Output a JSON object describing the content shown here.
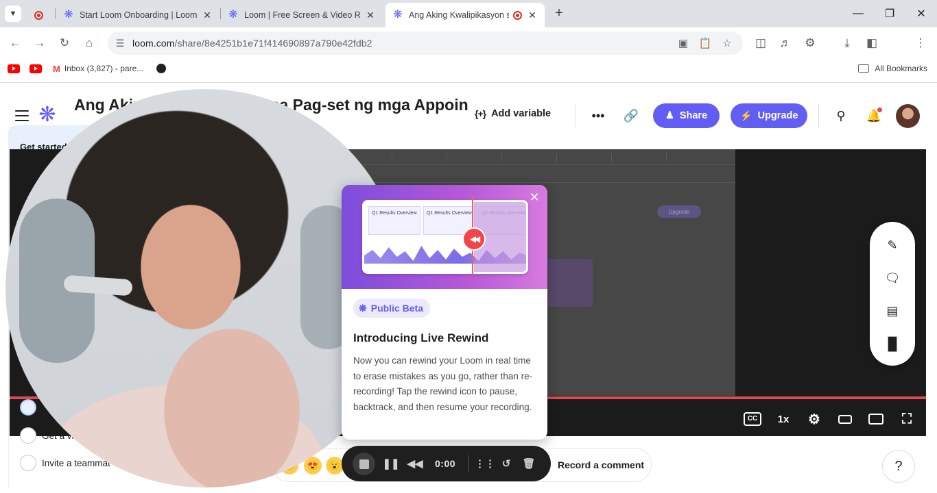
{
  "browser": {
    "tabs": [
      {
        "title": "",
        "icon": "recording-icon"
      },
      {
        "title": "Start Loom Onboarding | Loom",
        "icon": "loom-icon"
      },
      {
        "title": "Loom | Free Screen & Video Re",
        "icon": "loom-icon"
      },
      {
        "title": "Ang Aking Kwalipikasyon sa",
        "icon": "loom-icon",
        "active": true
      }
    ],
    "url_domain": "loom.com",
    "url_path": "/share/8e4251b1e71f414690897a790e42fdb2",
    "bookmarks": {
      "inbox": "Inbox (3,827) - pare...",
      "all": "All Bookmarks"
    }
  },
  "header": {
    "title": "Ang Aking Kwalipikasyon sa Pag-set ng mga Appoin...",
    "add_variable": "Add variable",
    "share": "Share",
    "upgrade": "Upgrade"
  },
  "onboarding": {
    "title": "Get started",
    "progress": 0.4,
    "tasks": [
      {
        "label": "S",
        "done": true
      },
      {
        "label": "Get a vi",
        "done": false
      },
      {
        "label": "Invite a teammat",
        "done": false
      }
    ]
  },
  "player": {
    "speed": "1x",
    "cc": "CC",
    "frame": {
      "upgrade": "Upgrade",
      "all_bookmarks": "All Bookmarks"
    }
  },
  "popup": {
    "badge": "Public Beta",
    "heading": "Introducing Live Rewind",
    "body": "Now you can rewind your Loom in real time to erase mistakes as you go, rather than re-recording! Tap the rewind icon to pause, backtrack, and then resume your recording.",
    "slide_title": "Q1 Results Overview"
  },
  "recorder": {
    "time": "0:00"
  },
  "comments": {
    "record_comment": "Record a comment"
  },
  "help": "?",
  "colors": {
    "accent": "#625df5",
    "record_red": "#e5484d"
  }
}
